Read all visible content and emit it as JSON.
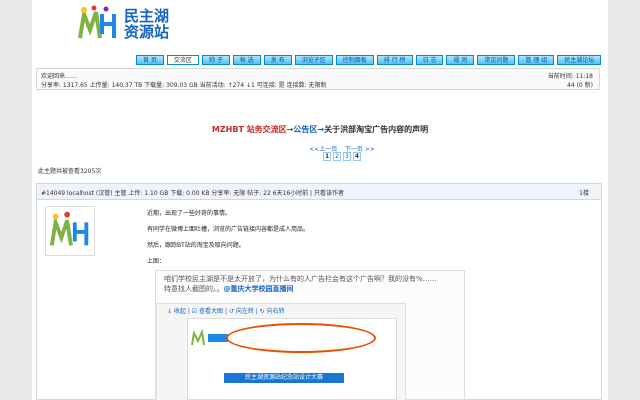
{
  "header": {
    "logo_text_line1": "民主湖",
    "logo_text_line2": "资源站"
  },
  "nav": [
    "首 页",
    "交流区",
    "帅 子",
    "帐 选",
    "发 布",
    "浏览子区",
    "控制面板",
    "排 行 榜",
    "日 志",
    "规 则",
    "常见问题",
    "管 理 组",
    "民主湖论坛"
  ],
  "stats": {
    "welcome": "欢迎回来……",
    "line2": "分享率: 1317.65 上传量: 140.37 TB 下载量: 309.03 GB 当前活动: ↑274 ↓1 可连接: 是 连接数: 无限制",
    "time": "当前时间: 11:18",
    "messages": "44 (0 新)"
  },
  "topic": {
    "prefix": "MZHBT 站务交流区→",
    "mid": "公告区→",
    "rest": "关于洪部淘宝广告内容的声明"
  },
  "pager": {
    "prev": "<<上一页",
    "next": "下一页 >>",
    "pages": [
      "1",
      "2",
      "3",
      "4"
    ]
  },
  "views": "此主题共被查看3205次",
  "post": {
    "meta": "#14049 localhost (汉管) 主管 上传: 1.10 GB 下载: 0.00 KB 分享率: 无限 帖子: 22 6天16小时前 | 只看该作者",
    "floor": "1楼",
    "lines": [
      "近期，出现了一些好奇的事情。",
      "有同学在微博上面吐槽，浏览的广告链接内容都是成人用品。",
      "然后，跟踪BT站的淘宝及取向问题。",
      "上图："
    ],
    "quote1": "咱们学校民主湖是不是太开放了，为什么有的人广告栏会有这个广告啊？我的没有%……",
    "quote2_pre": "特意找人截图的。。",
    "quote2_link": "@重庆大学校园直播间",
    "tools": "↓ 收起  | ☑ 查看大图 | ↺ 向左转 | ↻ 向右转",
    "banner": "民主湖资源站纪念站设计大赛"
  }
}
